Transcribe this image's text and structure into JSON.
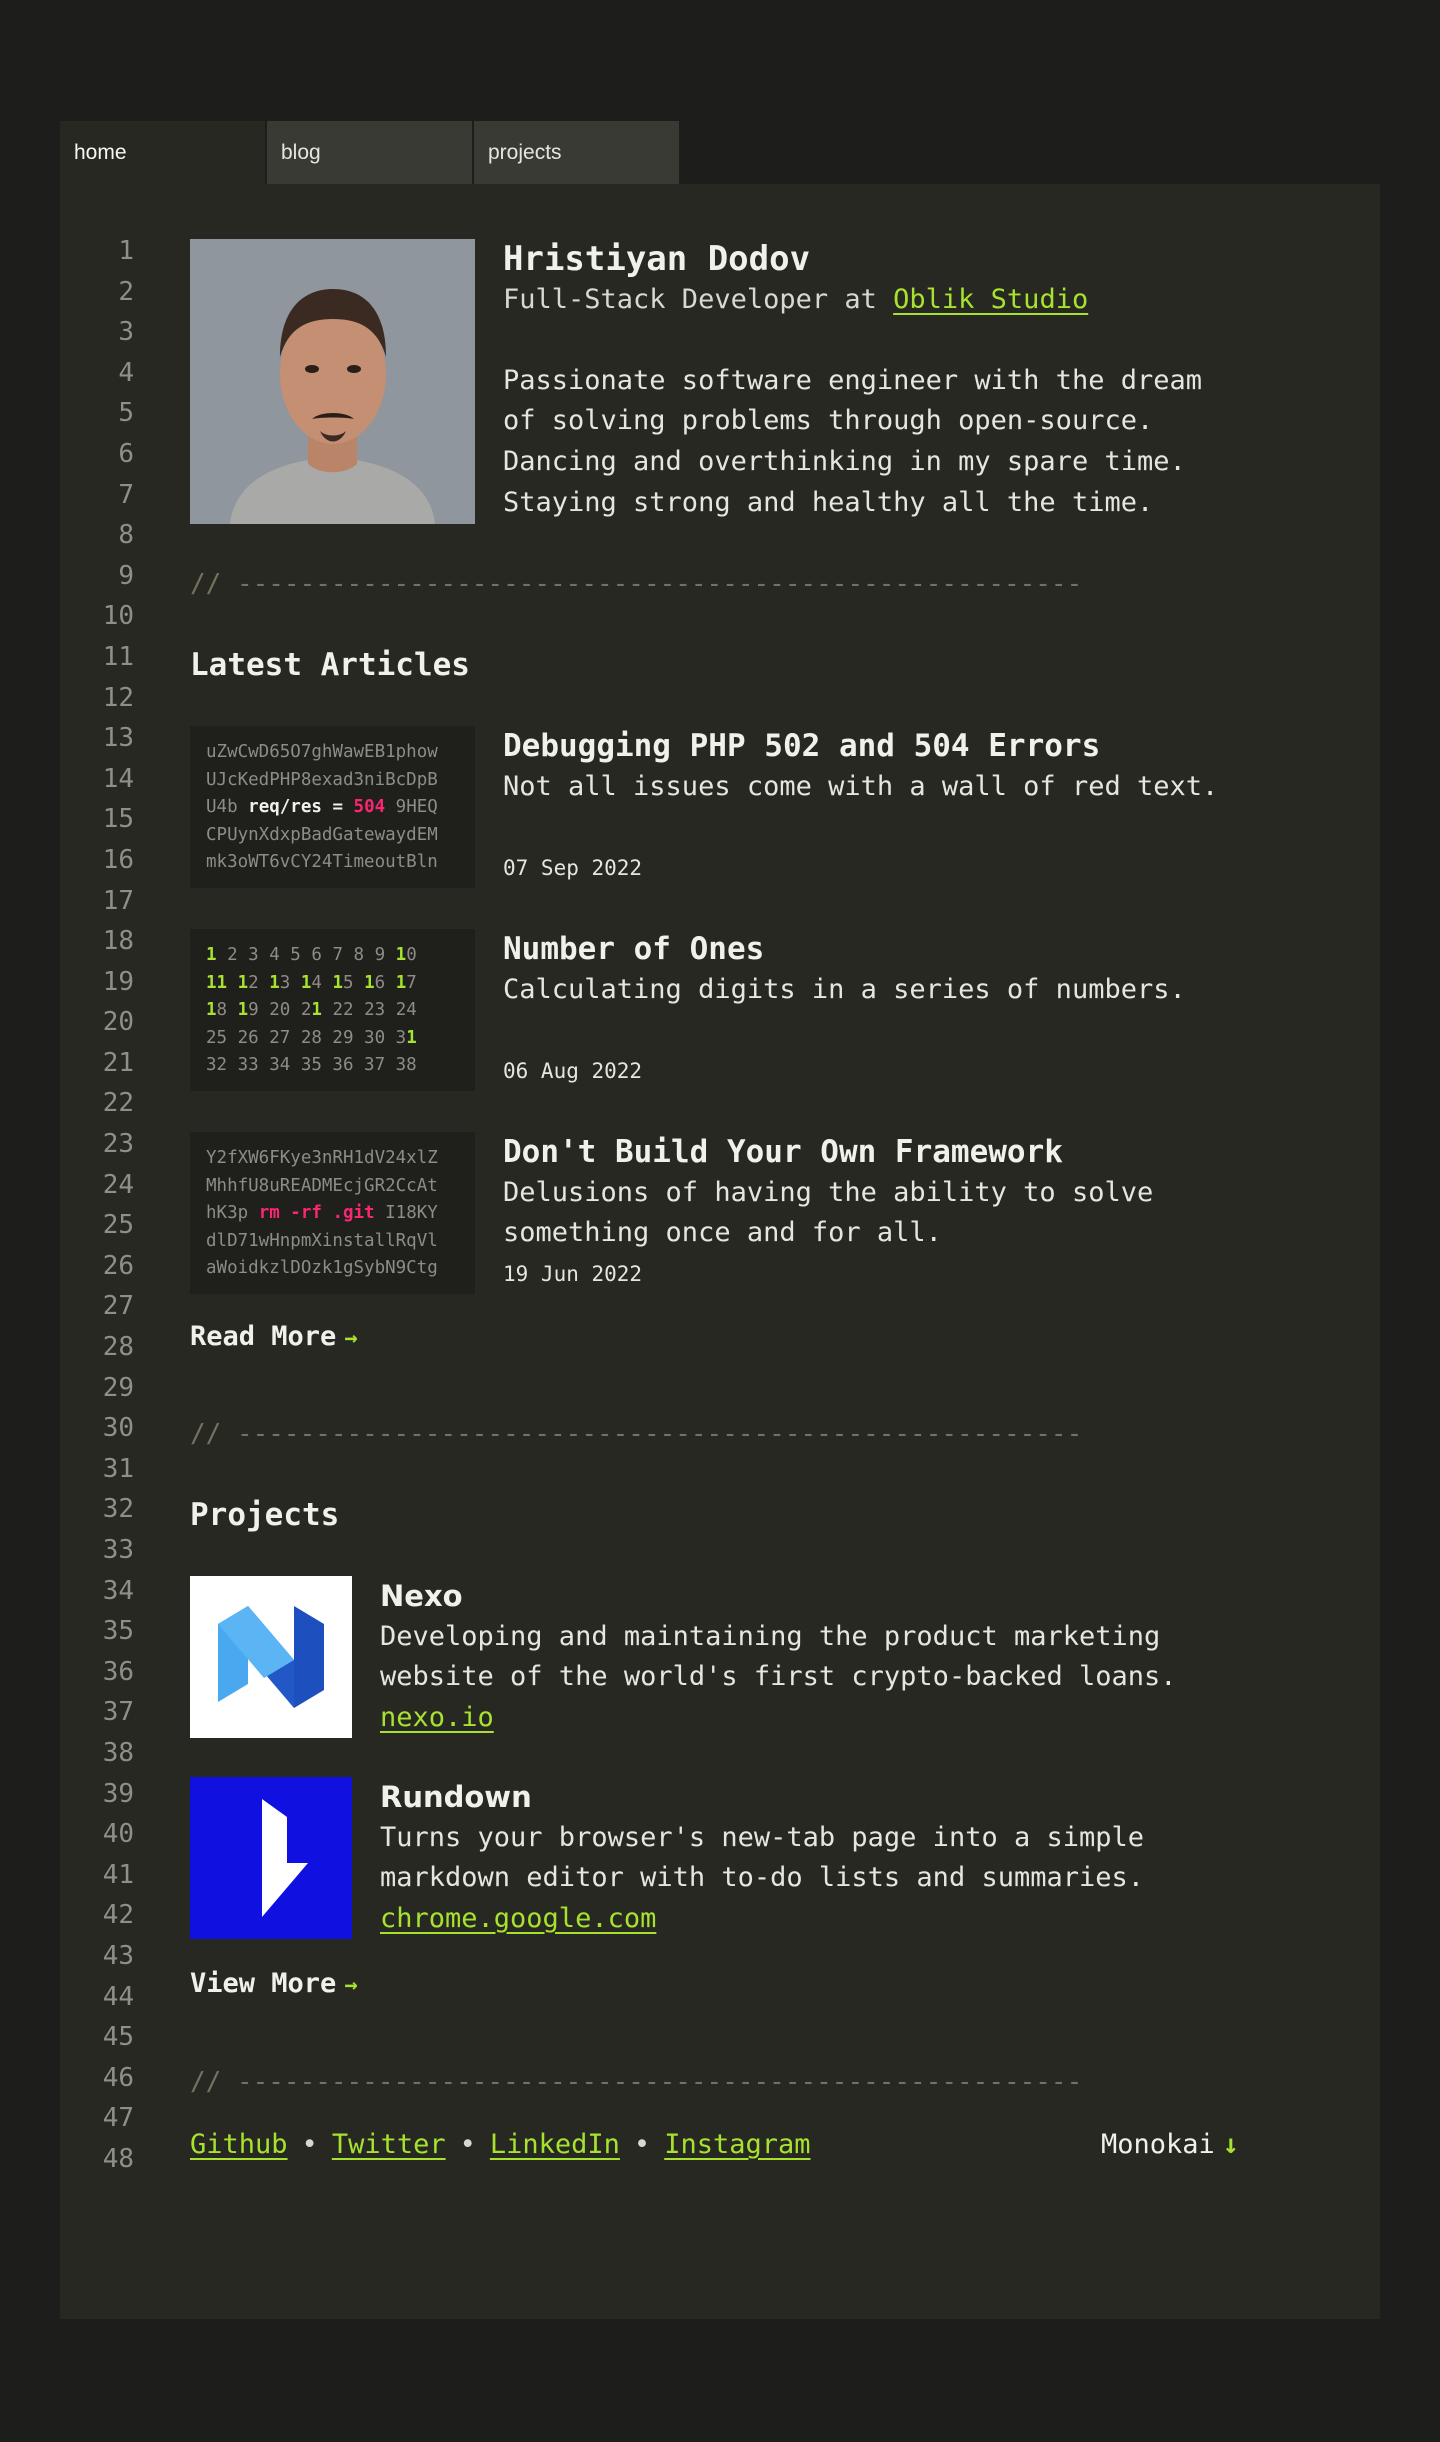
{
  "tabs": [
    {
      "label": "home"
    },
    {
      "label": "blog"
    },
    {
      "label": "projects"
    }
  ],
  "line_numbers": [
    "1",
    "2",
    "3",
    "4",
    "5",
    "6",
    "7",
    "8",
    "9",
    "10",
    "11",
    "12",
    "13",
    "14",
    "15",
    "16",
    "17",
    "18",
    "19",
    "20",
    "21",
    "22",
    "23",
    "24",
    "25",
    "26",
    "27",
    "28",
    "29",
    "30",
    "31",
    "32",
    "33",
    "34",
    "35",
    "36",
    "37",
    "38",
    "39",
    "40",
    "41",
    "42",
    "43",
    "44",
    "45",
    "46",
    "47",
    "48"
  ],
  "profile": {
    "name": "Hristiyan Dodov",
    "role_prefix": "Full-Stack Developer at ",
    "company": "Oblik Studio",
    "bio": "Passionate software engineer with the dream\nof solving problems through open-source.\nDancing and overthinking in my spare time.\nStaying strong and healthy all the time."
  },
  "divider": "// ------------------------------------------------------",
  "articles_section": {
    "title": "Latest Articles",
    "items": [
      {
        "title": "Debugging PHP 502 and 504 Errors",
        "desc": "Not all issues come with a wall of red text.",
        "date": "07 Sep 2022",
        "thumb": {
          "l1": "uZwCwD65O7ghWawEB1phow",
          "l2": "UJcKedPHP8exad3niBcDpB",
          "l3a": "U4b ",
          "l3b": "req/res",
          "l3c": " = ",
          "l3d": "504",
          "l3e": " 9HEQ",
          "l4": "CPUynXdxpBadGatewaydEM",
          "l5": "mk3oWT6vCY24TimeoutBln"
        }
      },
      {
        "title": "Number of Ones",
        "desc": "Calculating digits in a series of numbers.",
        "date": "06 Aug 2022",
        "thumb": {
          "rows": [
            [
              [
                "1",
                "g"
              ],
              [
                " 2 3 4 5 6 7 8 9 ",
                ""
              ],
              [
                "1",
                "g"
              ],
              [
                "0",
                ""
              ]
            ],
            [
              [
                "11",
                "g"
              ],
              [
                " ",
                ""
              ],
              [
                "1",
                "g"
              ],
              [
                "2 ",
                ""
              ],
              [
                "1",
                "g"
              ],
              [
                "3 ",
                ""
              ],
              [
                "1",
                "g"
              ],
              [
                "4 ",
                ""
              ],
              [
                "1",
                "g"
              ],
              [
                "5 ",
                ""
              ],
              [
                "1",
                "g"
              ],
              [
                "6 ",
                ""
              ],
              [
                "1",
                "g"
              ],
              [
                "7",
                ""
              ]
            ],
            [
              [
                "1",
                "g"
              ],
              [
                "8 ",
                ""
              ],
              [
                "1",
                "g"
              ],
              [
                "9 20 2",
                ""
              ],
              [
                "1",
                "g"
              ],
              [
                " 22 23 24",
                ""
              ]
            ],
            [
              [
                "25 26 27 28 29 30 3",
                ""
              ],
              [
                "1",
                "g"
              ]
            ],
            [
              [
                "32 33 34 35 36 37 38",
                ""
              ]
            ]
          ]
        }
      },
      {
        "title": "Don't Build Your Own Framework",
        "desc": "Delusions of having the ability to solve\nsomething once and for all.",
        "date": "19 Jun 2022",
        "thumb": {
          "l1": "Y2fXW6FKye3nRH1dV24xlZ",
          "l2": "MhhfU8uREADMEcjGR2CcAt",
          "l3a": "hK3p ",
          "l3b": "rm -rf .git",
          "l3c": " I18KY",
          "l4": "dlD71wHnpmXinstallRqVl",
          "l5": "aWoidkzlDOzk1gSybN9Ctg"
        }
      }
    ],
    "more_label": "Read More",
    "more_arrow": "→"
  },
  "projects_section": {
    "title": "Projects",
    "items": [
      {
        "name": "Nexo",
        "desc": "Developing and maintaining the product marketing\nwebsite of the world's first crypto-backed loans.",
        "link": "nexo.io",
        "logo_icon": "nexo-logo-icon",
        "logo_bg": "#ffffff"
      },
      {
        "name": "Rundown",
        "desc": "Turns your browser's new-tab page into a simple\nmarkdown editor with to-do lists and summaries.",
        "link": "chrome.google.com",
        "logo_icon": "rundown-logo-icon",
        "logo_bg": "#1010e0"
      }
    ],
    "more_label": "View More",
    "more_arrow": "→"
  },
  "footer": {
    "links": [
      "Github",
      "Twitter",
      "LinkedIn",
      "Instagram"
    ],
    "separator": "•",
    "theme_label": "Monokai",
    "theme_arrow": "↓"
  },
  "colors": {
    "background": "#1d1d1b",
    "editor": "#272822",
    "accent": "#a6e22e",
    "pink": "#f92672"
  }
}
